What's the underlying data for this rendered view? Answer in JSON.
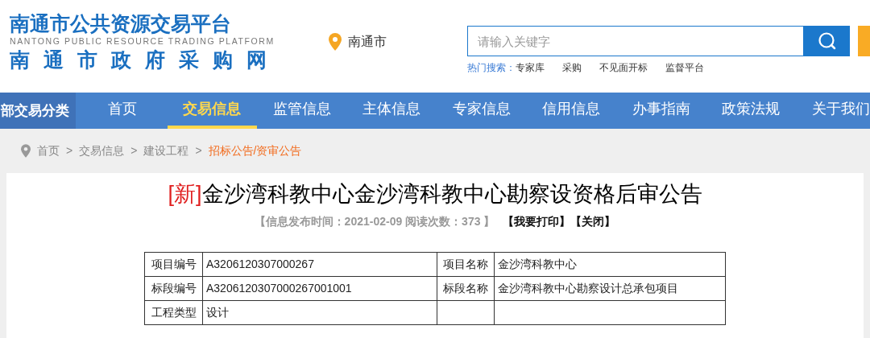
{
  "logo": {
    "title": "南通市公共资源交易平台",
    "subtitle": "NANTONG PUBLIC RESOURCE TRADING PLATFORM",
    "title_2": "南通市政府采购网"
  },
  "location": "南通市",
  "search": {
    "placeholder": "请输入关键字",
    "hot_label": "热门搜索：",
    "hot_terms": [
      "专家库",
      "采购",
      "不见面开标",
      "监督平台"
    ]
  },
  "nav": {
    "category": "部交易分类",
    "items": [
      {
        "label": "首页",
        "selected": false
      },
      {
        "label": "交易信息",
        "selected": true
      },
      {
        "label": "监管信息",
        "selected": false
      },
      {
        "label": "主体信息",
        "selected": false
      },
      {
        "label": "专家信息",
        "selected": false
      },
      {
        "label": "信用信息",
        "selected": false
      },
      {
        "label": "办事指南",
        "selected": false
      },
      {
        "label": "政策法规",
        "selected": false
      },
      {
        "label": "关于我们",
        "selected": false
      }
    ]
  },
  "breadcrumb": [
    {
      "label": "首页",
      "current": false
    },
    {
      "separator": ">",
      "label": "交易信息",
      "current": false
    },
    {
      "separator": ">",
      "label": "建设工程",
      "current": false
    },
    {
      "separator": ">",
      "label": "招标公告/资审公告",
      "current": true
    }
  ],
  "article": {
    "badge": "[新]",
    "title": "金沙湾科教中心金沙湾科教中心勘察设资格后审公告",
    "meta": "【信息发布时间：2021-02-09 阅读次数：373 】",
    "actions": [
      "【我要打印】",
      "【关闭】"
    ]
  },
  "table": {
    "rows": [
      [
        "项目编号",
        "A3206120307000267",
        "项目名称",
        "金沙湾科教中心"
      ],
      [
        "标段编号",
        "A3206120307000267001001",
        "标段名称",
        "金沙湾科教中心勘察设计总承包项目"
      ],
      [
        "工程类型",
        "设计"
      ]
    ]
  }
}
